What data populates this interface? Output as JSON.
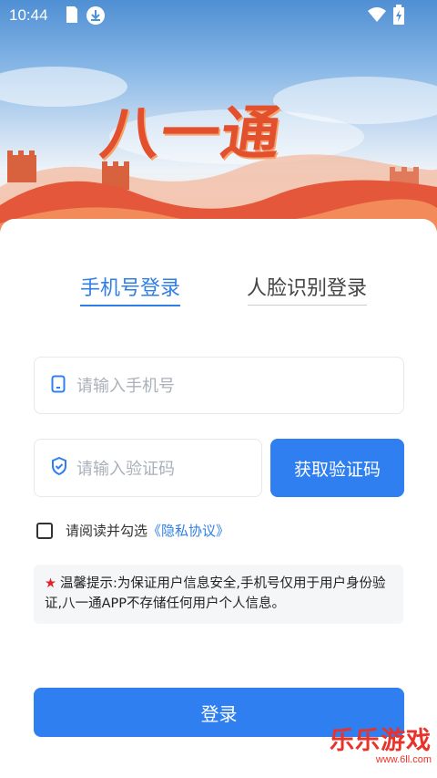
{
  "status_bar": {
    "time": "10:44"
  },
  "hero": {
    "logo_text": "八一通"
  },
  "tabs": [
    {
      "label": "手机号登录",
      "active": true
    },
    {
      "label": "人脸识别登录",
      "active": false
    }
  ],
  "phone_field": {
    "placeholder": "请输入手机号",
    "value": ""
  },
  "code_field": {
    "placeholder": "请输入验证码",
    "value": ""
  },
  "get_code_button": {
    "label": "获取验证码"
  },
  "agreement": {
    "text": "请阅读并勾选",
    "link": "《隐私协议》",
    "checked": false
  },
  "notice": {
    "star": "★",
    "text": "温馨提示:为保证用户信息安全,手机号仅用于用户身份验证,八一通APP不存储任何用户个人信息。"
  },
  "login_button": {
    "label": "登录"
  },
  "watermark": {
    "brand": "乐乐游戏",
    "url": "www.6ll.com"
  },
  "colors": {
    "accent": "#2f7ff0",
    "tab_active": "#2f7fe6",
    "star": "#e0202a"
  }
}
